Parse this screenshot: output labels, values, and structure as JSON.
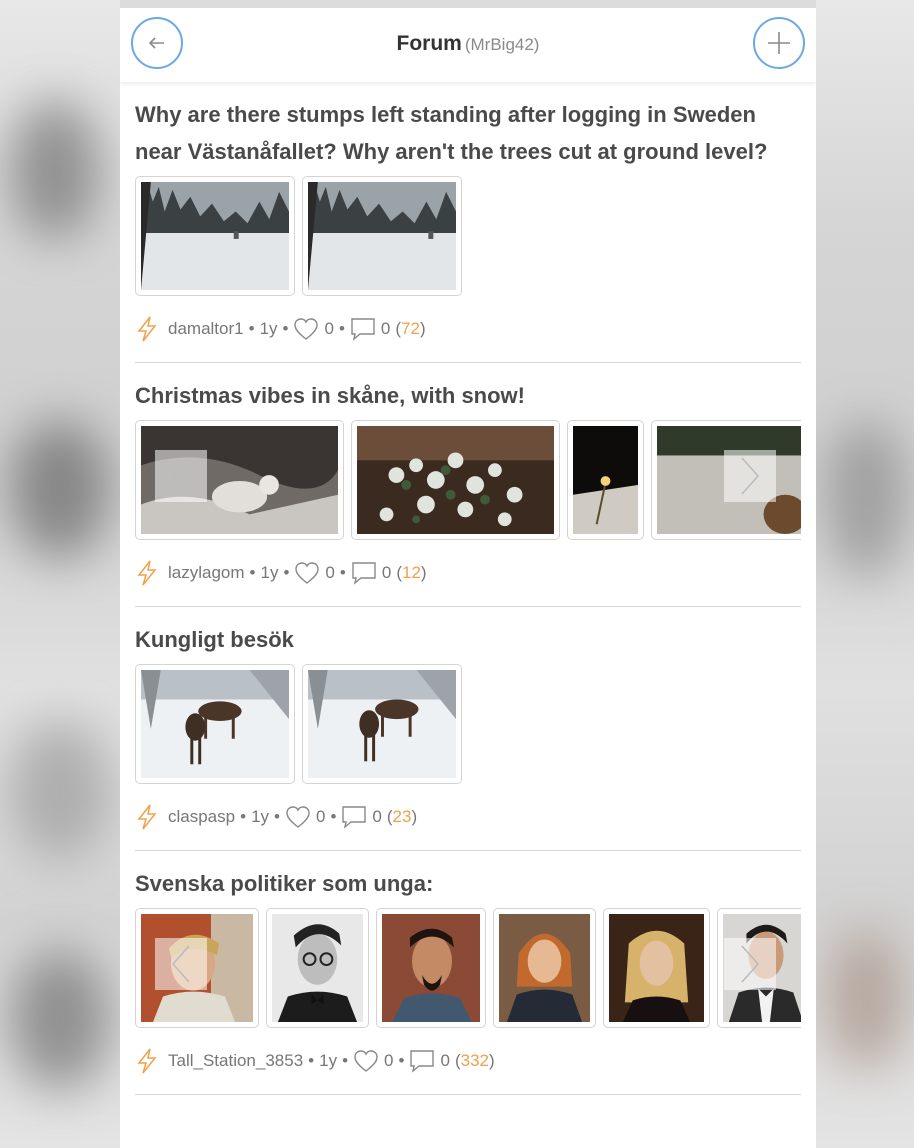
{
  "header": {
    "title": "Forum",
    "subtitle": "(MrBig42)",
    "back_icon": "arrow-left-icon",
    "add_icon": "plus-icon",
    "accent_color": "#6aa8e8"
  },
  "posts": [
    {
      "title": "Why are there stumps left standing after logging in Sweden near Västanåfallet? Why aren't the trees cut at ground level?",
      "author": "damaltor1",
      "age": "1y",
      "likes": "0",
      "comments": "0",
      "views": "72",
      "has_arrows": false
    },
    {
      "title": "Christmas vibes in skåne, with snow!",
      "author": "lazylagom",
      "age": "1y",
      "likes": "0",
      "comments": "0",
      "views": "12",
      "has_arrows": true
    },
    {
      "title": "Kungligt besök",
      "author": "claspasp",
      "age": "1y",
      "likes": "0",
      "comments": "0",
      "views": "23",
      "has_arrows": false
    },
    {
      "title": "Svenska politiker som unga:",
      "author": "Tall_Station_3853",
      "age": "1y",
      "likes": "0",
      "comments": "0",
      "views": "332",
      "has_arrows": true
    }
  ],
  "colors": {
    "views_count": "#f0a14a",
    "bolt": "#f0a14a"
  }
}
